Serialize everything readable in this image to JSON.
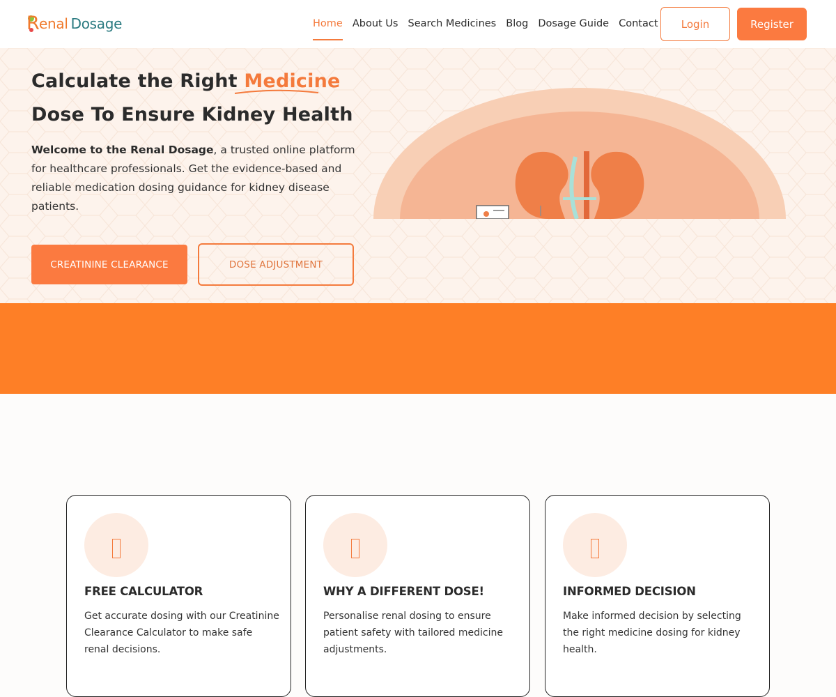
{
  "header": {
    "logo": {
      "letter": "R",
      "text_primary": "enal",
      "text_secondary": "Dosage",
      "icon": "renal-dosage-logo"
    },
    "nav": [
      {
        "label": "Home",
        "active": true
      },
      {
        "label": "About Us",
        "active": false
      },
      {
        "label": "Search Medicines",
        "active": false
      },
      {
        "label": "Blog",
        "active": false
      },
      {
        "label": "Dosage Guide",
        "active": false
      },
      {
        "label": "Contact Us",
        "active": false
      }
    ],
    "login_label": "Login",
    "register_label": "Register"
  },
  "hero": {
    "title_part1": "Calculate the Right ",
    "title_accent": "Medicine",
    "title_line2": "Dose To Ensure Kidney Health",
    "desc_bold": "Welcome to the Renal Dosage",
    "desc_rest": ", a trusted online platform for healthcare professionals. Get the evidence-based and reliable medication dosing guidance for kidney disease patients.",
    "primary_button": "CREATININE CLEARANCE",
    "secondary_button": "DOSE ADJUSTMENT",
    "illustration": "kidney-illustration"
  },
  "features": [
    {
      "icon": "calculator-icon",
      "title": "FREE CALCULATOR",
      "text": "Get accurate dosing with our Creatinine Clearance Calculator to make safe renal decisions."
    },
    {
      "icon": "dose-icon",
      "title": "WHY A DIFFERENT DOSE!",
      "text": "Personalise renal dosing to ensure patient safety with tailored medicine adjustments."
    },
    {
      "icon": "decision-icon",
      "title": "INFORMED DECISION",
      "text": "Make informed decision by selecting the right medicine dosing for kidney health."
    }
  ],
  "colors": {
    "accent": "#f47a3c",
    "button": "#fb7a40",
    "band": "#fe7f26",
    "hero_bg": "#fdf3ec",
    "logo_teal": "#2a7a80"
  }
}
